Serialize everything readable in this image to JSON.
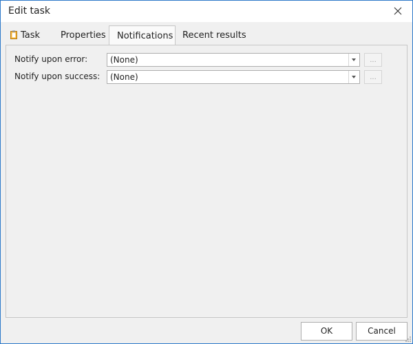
{
  "window": {
    "title": "Edit task"
  },
  "tabs": [
    {
      "label": "Task",
      "icon": "clipboard-icon"
    },
    {
      "label": "Properties"
    },
    {
      "label": "Notifications"
    },
    {
      "label": "Recent results"
    }
  ],
  "active_tab": "Notifications",
  "notifications": {
    "error": {
      "label": "Notify upon error:",
      "value": "(None)",
      "browse": "..."
    },
    "success": {
      "label": "Notify upon success:",
      "value": "(None)",
      "browse": "..."
    }
  },
  "footer": {
    "ok_label": "OK",
    "cancel_label": "Cancel"
  },
  "colors": {
    "window_border": "#2b78c9",
    "accent": "#2b78c9"
  }
}
